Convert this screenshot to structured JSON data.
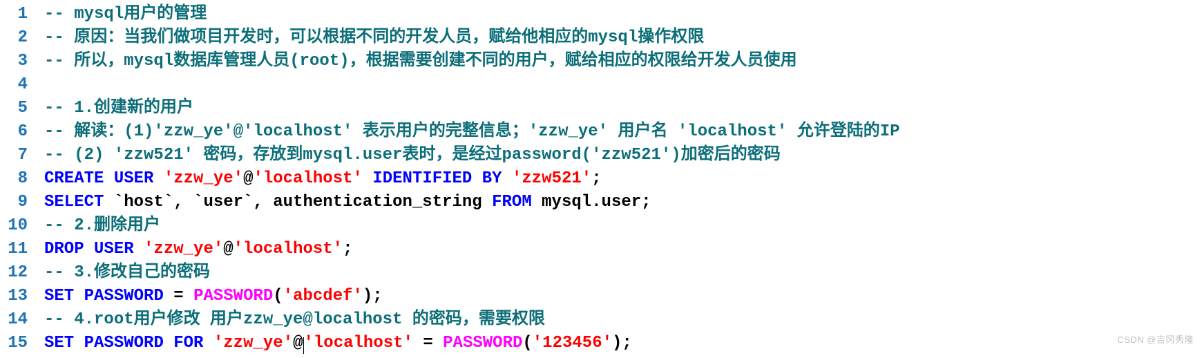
{
  "watermark": "CSDN @吉冈秀隆",
  "lines": [
    {
      "num": "1",
      "tokens": [
        {
          "c": "comment",
          "t": "-- mysql用户的管理"
        }
      ]
    },
    {
      "num": "2",
      "tokens": [
        {
          "c": "comment",
          "t": "-- 原因：当我们做项目开发时，可以根据不同的开发人员，赋给他相应的mysql操作权限"
        }
      ]
    },
    {
      "num": "3",
      "tokens": [
        {
          "c": "comment",
          "t": "-- 所以，mysql数据库管理人员(root)，根据需要创建不同的用户，赋给相应的权限给开发人员使用"
        }
      ]
    },
    {
      "num": "4",
      "tokens": []
    },
    {
      "num": "5",
      "tokens": [
        {
          "c": "comment",
          "t": "-- 1.创建新的用户"
        }
      ]
    },
    {
      "num": "6",
      "tokens": [
        {
          "c": "comment",
          "t": "-- 解读：(1)'zzw_ye'@'localhost' 表示用户的完整信息；'zzw_ye' 用户名 'localhost' 允许登陆的IP"
        }
      ]
    },
    {
      "num": "7",
      "tokens": [
        {
          "c": "comment",
          "t": "-- (2) 'zzw521' 密码，存放到mysql.user表时，是经过password('zzw521')加密后的密码"
        }
      ]
    },
    {
      "num": "8",
      "tokens": [
        {
          "c": "keyword",
          "t": "CREATE"
        },
        {
          "c": "text",
          "t": " "
        },
        {
          "c": "keyword",
          "t": "USER"
        },
        {
          "c": "text",
          "t": " "
        },
        {
          "c": "string",
          "t": "'zzw_ye'"
        },
        {
          "c": "text",
          "t": "@"
        },
        {
          "c": "string",
          "t": "'localhost'"
        },
        {
          "c": "text",
          "t": " "
        },
        {
          "c": "keyword",
          "t": "IDENTIFIED"
        },
        {
          "c": "text",
          "t": " "
        },
        {
          "c": "keyword",
          "t": "BY"
        },
        {
          "c": "text",
          "t": " "
        },
        {
          "c": "string",
          "t": "'zzw521'"
        },
        {
          "c": "text",
          "t": ";"
        }
      ]
    },
    {
      "num": "9",
      "tokens": [
        {
          "c": "keyword",
          "t": "SELECT"
        },
        {
          "c": "text",
          "t": " `host`, `user`, authentication_string "
        },
        {
          "c": "keyword",
          "t": "FROM"
        },
        {
          "c": "text",
          "t": " mysql.user;"
        }
      ]
    },
    {
      "num": "10",
      "tokens": [
        {
          "c": "comment",
          "t": "-- 2.删除用户"
        }
      ]
    },
    {
      "num": "11",
      "tokens": [
        {
          "c": "keyword",
          "t": "DROP"
        },
        {
          "c": "text",
          "t": " "
        },
        {
          "c": "keyword",
          "t": "USER"
        },
        {
          "c": "text",
          "t": " "
        },
        {
          "c": "string",
          "t": "'zzw_ye'"
        },
        {
          "c": "text",
          "t": "@"
        },
        {
          "c": "string",
          "t": "'localhost'"
        },
        {
          "c": "text",
          "t": ";"
        }
      ]
    },
    {
      "num": "12",
      "tokens": [
        {
          "c": "comment",
          "t": "-- 3.修改自己的密码"
        }
      ]
    },
    {
      "num": "13",
      "tokens": [
        {
          "c": "keyword",
          "t": "SET"
        },
        {
          "c": "text",
          "t": " "
        },
        {
          "c": "keyword",
          "t": "PASSWORD"
        },
        {
          "c": "text",
          "t": " = "
        },
        {
          "c": "func",
          "t": "PASSWORD"
        },
        {
          "c": "text",
          "t": "("
        },
        {
          "c": "string",
          "t": "'abcdef'"
        },
        {
          "c": "text",
          "t": ");"
        }
      ]
    },
    {
      "num": "14",
      "tokens": [
        {
          "c": "comment",
          "t": "-- 4.root用户修改 用户zzw_ye@localhost 的密码，需要权限"
        }
      ]
    },
    {
      "num": "15",
      "tokens": [
        {
          "c": "keyword",
          "t": "SET"
        },
        {
          "c": "text",
          "t": " "
        },
        {
          "c": "keyword",
          "t": "PASSWORD"
        },
        {
          "c": "text",
          "t": " "
        },
        {
          "c": "keyword",
          "t": "FOR"
        },
        {
          "c": "text",
          "t": " "
        },
        {
          "c": "string",
          "t": "'zzw_ye'"
        },
        {
          "c": "text",
          "t": "@"
        },
        {
          "caret": true
        },
        {
          "c": "string",
          "t": "'localhost'"
        },
        {
          "c": "text",
          "t": " = "
        },
        {
          "c": "func",
          "t": "PASSWORD"
        },
        {
          "c": "text",
          "t": "("
        },
        {
          "c": "string",
          "t": "'123456'"
        },
        {
          "c": "text",
          "t": ");"
        }
      ]
    }
  ]
}
